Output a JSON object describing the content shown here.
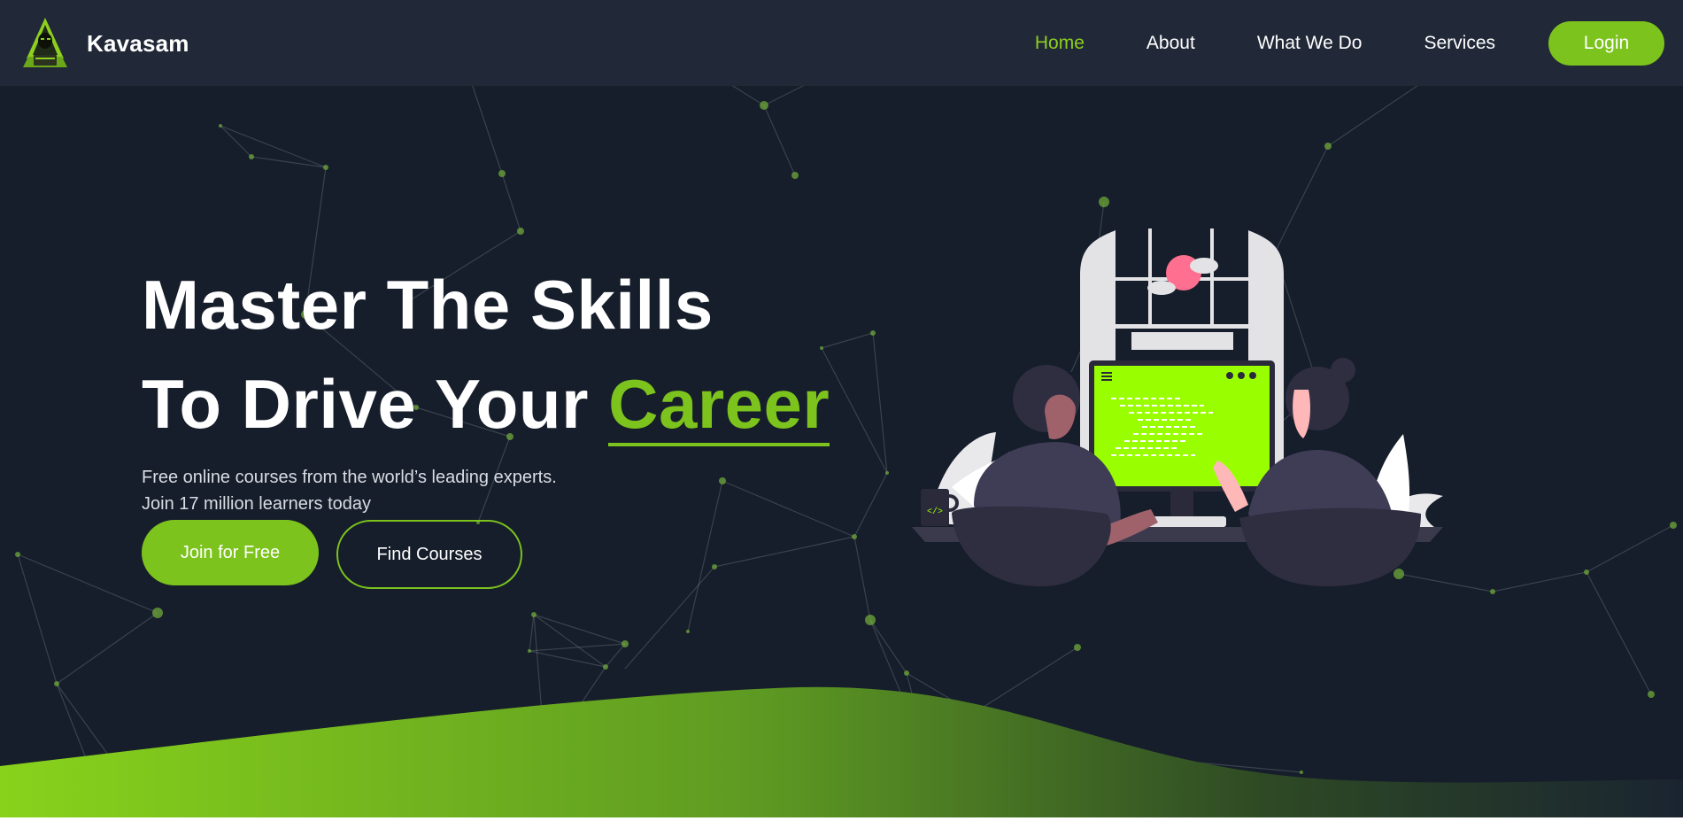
{
  "brand": {
    "name": "Kavasam",
    "logo_icon": "hooded-hacker-icon"
  },
  "nav": {
    "items": [
      {
        "label": "Home",
        "active": true
      },
      {
        "label": "About",
        "active": false
      },
      {
        "label": "What We Do",
        "active": false
      },
      {
        "label": "Services",
        "active": false
      }
    ],
    "login_label": "Login"
  },
  "hero": {
    "title_line1": "Master The Skills",
    "title_line2": "To Drive Your",
    "title_accent": "Career",
    "subtitle_line1": "Free online courses from the world’s leading experts.",
    "subtitle_line2": "Join 17 million learners today",
    "primary_cta": "Join for Free",
    "secondary_cta": "Find Courses"
  },
  "colors": {
    "background": "#161d2b",
    "header": "#212938",
    "accent": "#7cc31d",
    "screen": "#99ff00"
  },
  "illustration": {
    "name": "two-people-coding-illustration",
    "mug_label": "</>"
  }
}
